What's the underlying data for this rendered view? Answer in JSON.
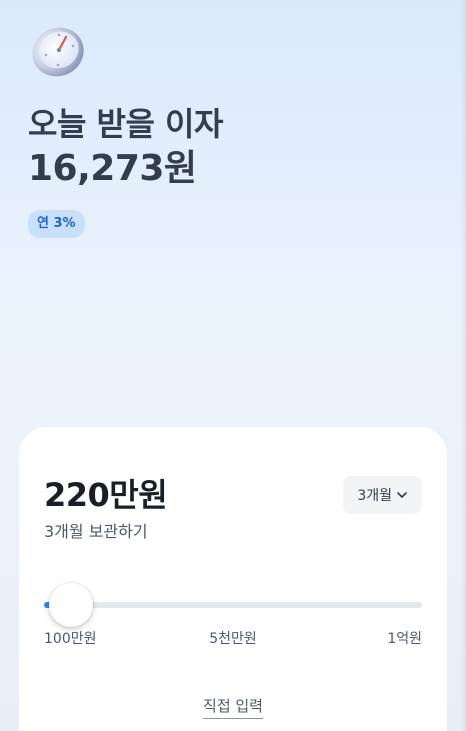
{
  "header": {
    "icon": "stopwatch-icon",
    "headline": "오늘 받을 이자",
    "interest_amount": "16,273원",
    "rate_badge": "연 3%"
  },
  "card": {
    "deposit_amount": "220만원",
    "subtitle": "3개월 보관하기",
    "period_button": {
      "label": "3개월",
      "icon": "chevron-down-icon"
    },
    "slider": {
      "min_label": "100만원",
      "mid_label": "5천만원",
      "max_label": "1억원",
      "min_value": 1000000,
      "max_value": 100000000,
      "current_value": 2200000
    },
    "direct_input_label": "직접 입력"
  },
  "colors": {
    "accent": "#3182f6",
    "badge_text": "#1b64da",
    "badge_bg": "#c9e0fb",
    "title_text": "#333d4b"
  }
}
